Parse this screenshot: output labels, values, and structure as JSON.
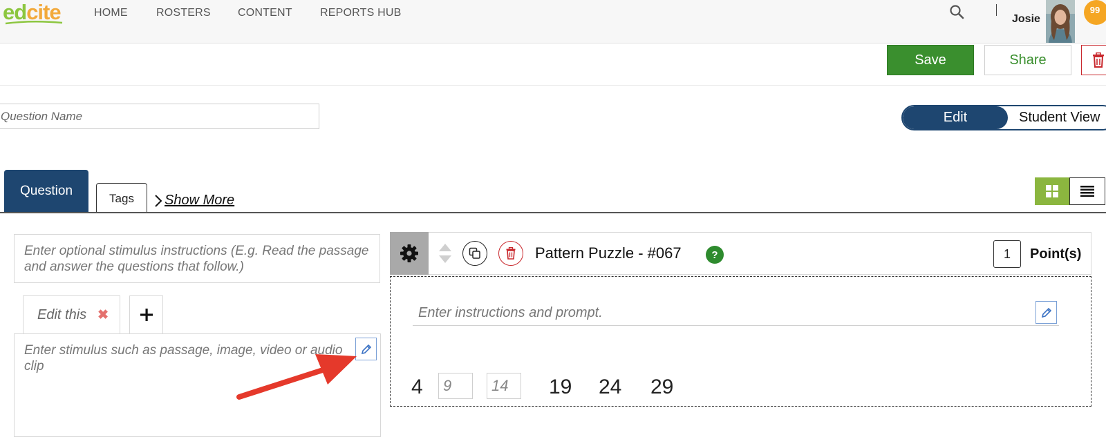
{
  "app": {
    "logo_ed": "ed",
    "logo_cite": "cite"
  },
  "nav": {
    "items": [
      {
        "label": "HOME"
      },
      {
        "label": "ROSTERS"
      },
      {
        "label": "CONTENT"
      },
      {
        "label": "REPORTS HUB"
      }
    ],
    "user_name": "Josie",
    "notification_count": "99"
  },
  "actions": {
    "save_label": "Save",
    "share_label": "Share"
  },
  "question_name": {
    "placeholder": "Question Name",
    "value": ""
  },
  "view_toggle": {
    "edit_label": "Edit",
    "student_label": "Student View",
    "selected": "Edit"
  },
  "tabs": {
    "question_label": "Question",
    "tags_label": "Tags",
    "show_more_label": "Show More"
  },
  "stimulus": {
    "instructions_placeholder": "Enter optional stimulus instructions (E.g. Read the passage and answer the questions that follow.)",
    "tab_label": "Edit this",
    "content_placeholder": "Enter stimulus such as passage, image, video or audio clip"
  },
  "question": {
    "title": "Pattern Puzzle - #067",
    "help_label": "?",
    "points_value": "1",
    "points_label": "Point(s)",
    "prompt_placeholder": "Enter instructions and prompt.",
    "sequence": {
      "n1": "4",
      "blank1_placeholder": "9",
      "blank2_placeholder": "14",
      "n2": "19",
      "n3": "24",
      "n4": "29"
    }
  },
  "colors": {
    "primary_navy": "#1e4670",
    "save_green": "#3a8f2e",
    "danger_red": "#c9282d",
    "grid_view_green": "#8bb63f",
    "annotation_arrow": "#e5392b"
  }
}
